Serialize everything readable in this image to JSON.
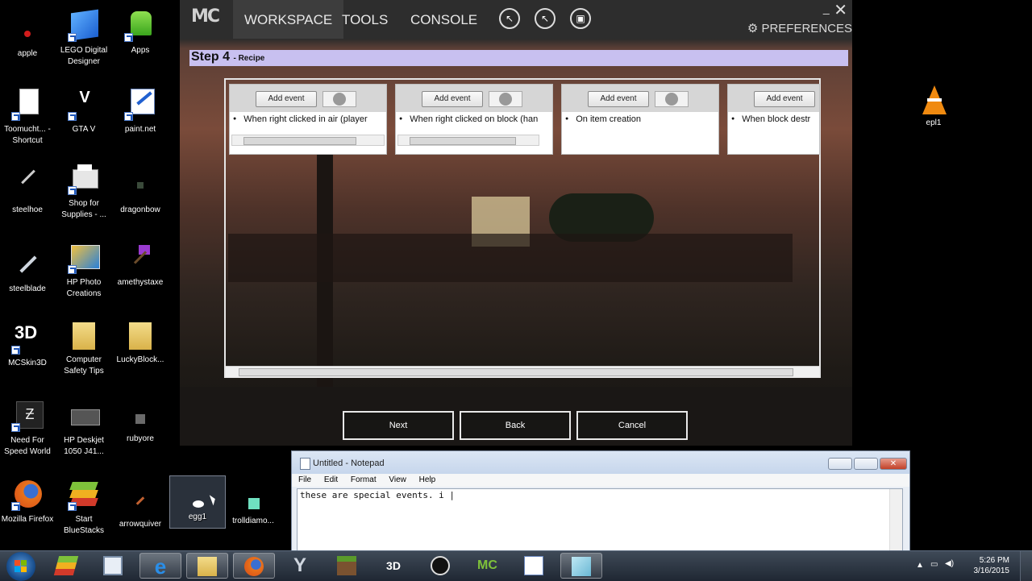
{
  "desktop": {
    "icons": [
      {
        "label": "apple"
      },
      {
        "label": "LEGO Digital Designer"
      },
      {
        "label": "Apps"
      },
      {
        "label": "Toomucht... - Shortcut"
      },
      {
        "label": "GTA V"
      },
      {
        "label": "paint.net"
      },
      {
        "label": "steelhoe"
      },
      {
        "label": "Shop for Supplies - ..."
      },
      {
        "label": "dragonbow"
      },
      {
        "label": "steelblade"
      },
      {
        "label": "HP Photo Creations"
      },
      {
        "label": "amethystaxe"
      },
      {
        "label": "MCSkin3D"
      },
      {
        "label": "Computer Safety Tips"
      },
      {
        "label": "LuckyBlock..."
      },
      {
        "label": "Need For Speed World"
      },
      {
        "label": "HP Deskjet 1050 J41..."
      },
      {
        "label": "rubyore"
      },
      {
        "label": "Mozilla Firefox"
      },
      {
        "label": "Start BlueStacks"
      },
      {
        "label": "arrowquiver"
      },
      {
        "label": "egg1"
      },
      {
        "label": "trolldiamo..."
      },
      {
        "label": "epl1"
      }
    ]
  },
  "mcreator": {
    "logo": "MC",
    "nav": [
      "WORKSPACE",
      "TOOLS",
      "CONSOLE"
    ],
    "preferences": "PREFERENCES",
    "step_title": "Step 4",
    "step_subtitle": "- Recipe",
    "events": [
      {
        "add_label": "Add event",
        "item": "When right clicked in air (player"
      },
      {
        "add_label": "Add event",
        "item": "When right clicked on block (han"
      },
      {
        "add_label": "Add event",
        "item": "On item creation"
      },
      {
        "add_label": "Add event",
        "item": "When block destr"
      }
    ],
    "buttons": {
      "next": "Next",
      "back": "Back",
      "cancel": "Cancel"
    }
  },
  "notepad": {
    "title": "Untitled - Notepad",
    "menu": [
      "File",
      "Edit",
      "Format",
      "View",
      "Help"
    ],
    "text": "these are special events. i |"
  },
  "taskbar": {
    "time": "5:26 PM",
    "date": "3/16/2015"
  }
}
